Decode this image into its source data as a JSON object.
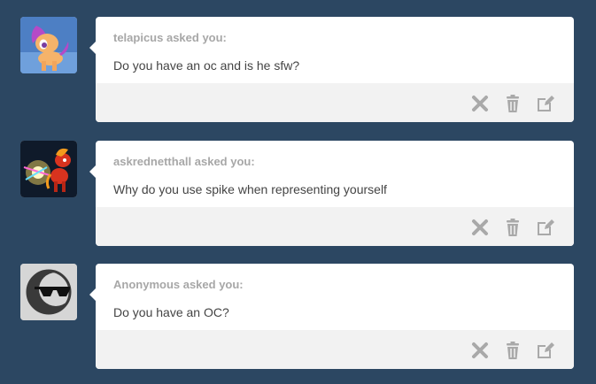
{
  "posts": [
    {
      "avatar": "pony-avatar",
      "asker": "telapicus asked you:",
      "question": "Do you have an oc and is he sfw?",
      "icons": [
        "close-icon",
        "trash-icon",
        "edit-icon"
      ]
    },
    {
      "avatar": "glowing-pony-avatar",
      "asker": "askrednetthall asked you:",
      "question": "Why do you use spike when representing yourself",
      "icons": [
        "close-icon",
        "trash-icon",
        "edit-icon"
      ]
    },
    {
      "avatar": "anonymous-sunglasses-avatar",
      "asker": "Anonymous asked you:",
      "question": "Do you have an OC?",
      "icons": [
        "close-icon",
        "trash-icon",
        "edit-icon"
      ]
    }
  ],
  "colors": {
    "background": "#2c4762",
    "card": "#ffffff",
    "footer": "#f2f2f2",
    "asker_text": "#a7a7a7",
    "question_text": "#444444",
    "icon": "#a9a9a9"
  }
}
